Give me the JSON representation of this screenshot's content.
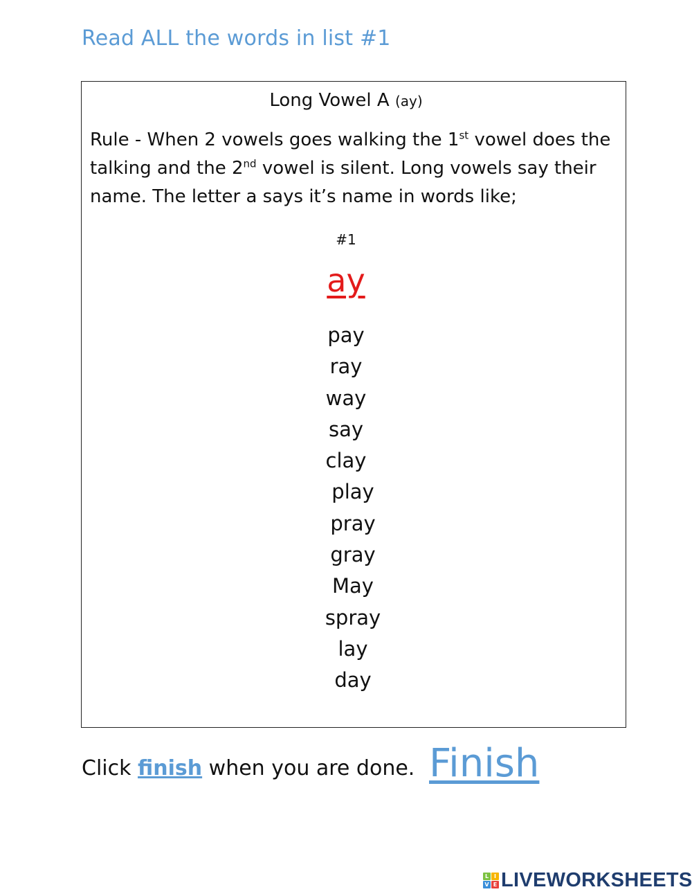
{
  "instruction": "Read ALL the words in list #1",
  "worksheet": {
    "title": "Long Vowel A",
    "title_suffix": "(ay)",
    "rule": {
      "part1": "Rule - When 2 vowels goes walking the 1",
      "sup1": "st",
      "part2": " vowel does the talking and the 2",
      "sup2": "nd",
      "part3": " vowel is silent.  Long vowels say their name. The letter a says it’s name in words like;"
    },
    "list_number": "#1",
    "pattern": "ay",
    "pattern_color": "#e31b1b",
    "words": [
      "pay",
      "ray",
      "way",
      "say",
      "clay",
      "play",
      "pray",
      "gray",
      "May",
      "spray",
      "lay",
      "day"
    ]
  },
  "footer": {
    "prefix": "Click ",
    "link": "finish",
    "suffix": " when you are done.",
    "finish_button": "Finish",
    "accent_color": "#5b9bd5"
  },
  "brand": {
    "logo_letters": [
      "L",
      "I",
      "V",
      "E"
    ],
    "name": "LIVEWORKSHEETS"
  }
}
